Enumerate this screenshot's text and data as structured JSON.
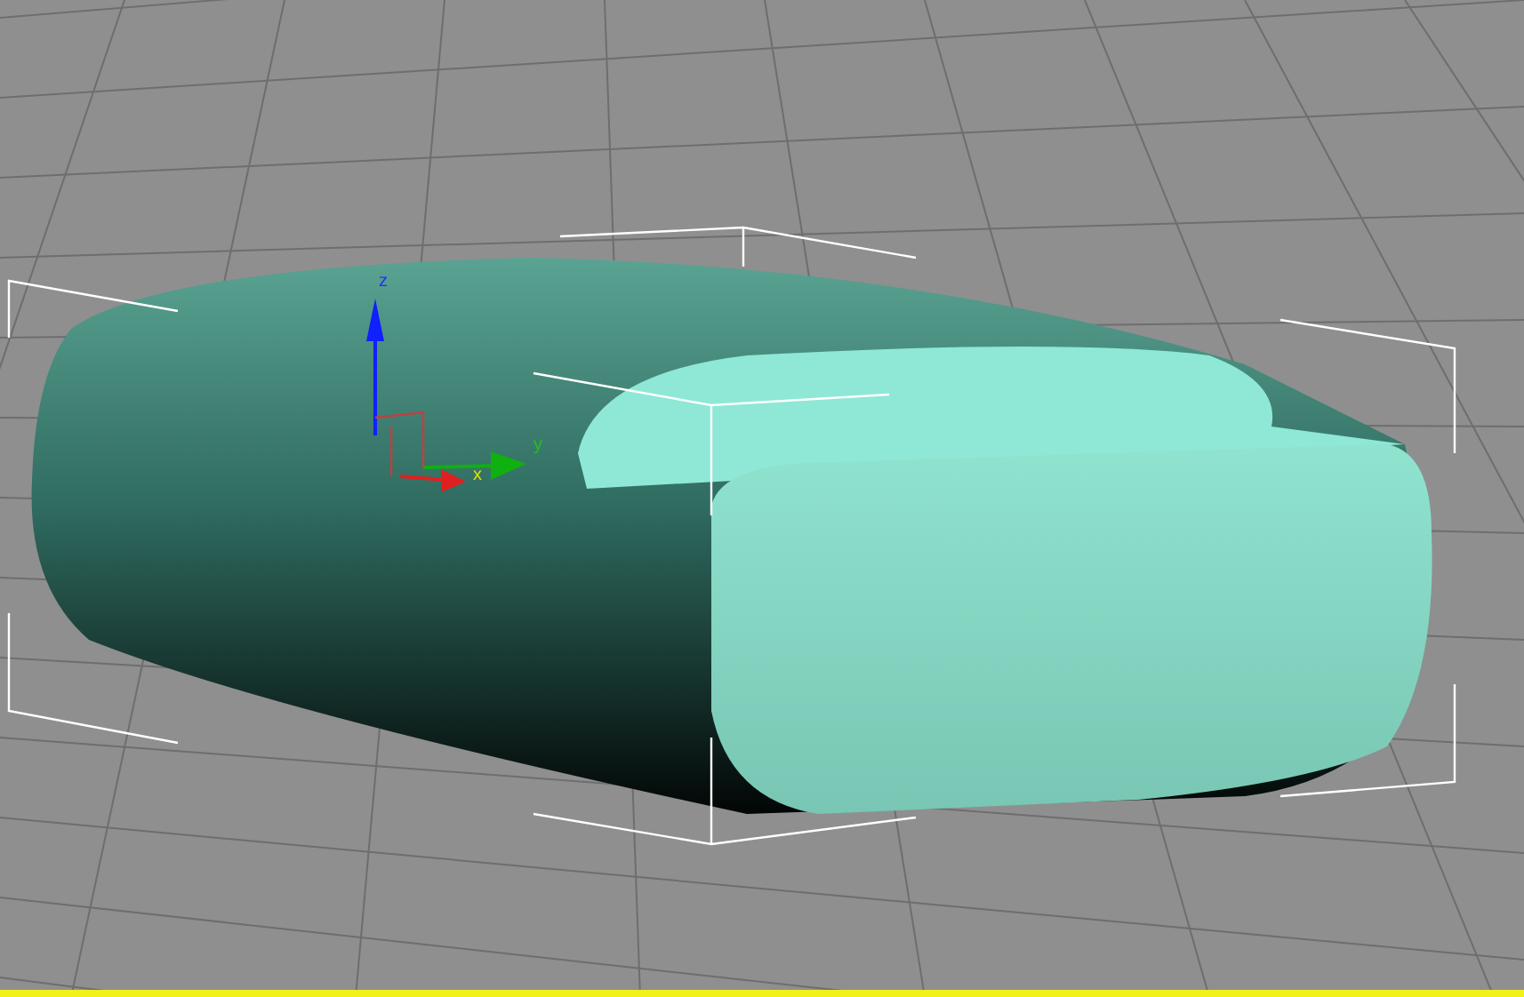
{
  "viewport": {
    "active": true,
    "gizmo": {
      "axis_labels": [
        "z",
        "x",
        "y"
      ]
    }
  }
}
